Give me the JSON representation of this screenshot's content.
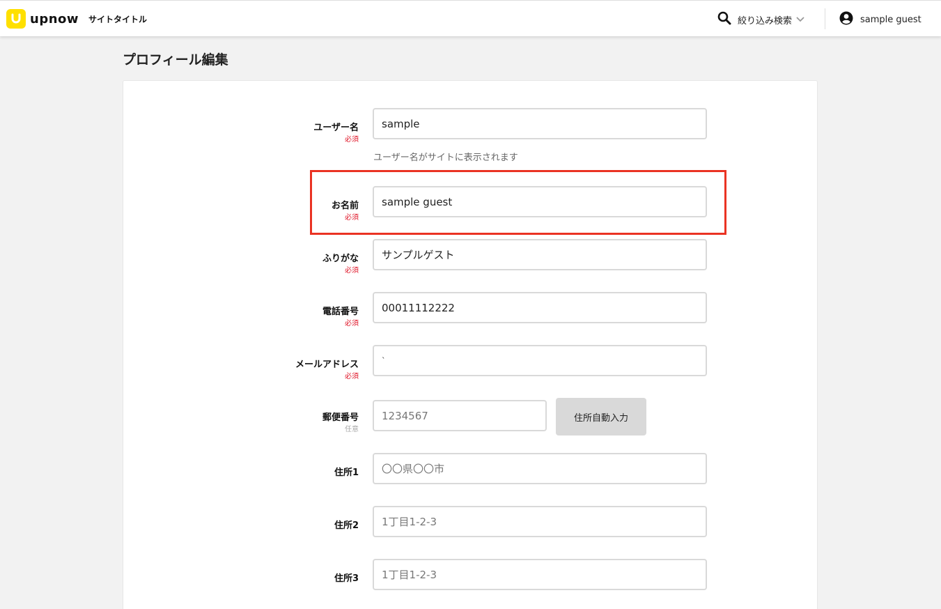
{
  "header": {
    "logo_text": "upnow",
    "site_title": "サイトタイトル",
    "search_label": "絞り込み検索",
    "user_name": "sample guest"
  },
  "page_title": "プロフィール編集",
  "form": {
    "username": {
      "label": "ユーザー名",
      "badge": "必須",
      "value": "sample",
      "helper": "ユーザー名がサイトに表示されます"
    },
    "name": {
      "label": "お名前",
      "badge": "必須",
      "value": "sample guest"
    },
    "furigana": {
      "label": "ふりがな",
      "badge": "必須",
      "value": "サンプルゲスト"
    },
    "phone": {
      "label": "電話番号",
      "badge": "必須",
      "value": "00011112222"
    },
    "email": {
      "label": "メールアドレス",
      "badge": "必須",
      "value": "`"
    },
    "postal": {
      "label": "郵便番号",
      "badge": "任意",
      "placeholder": "1234567",
      "button": "住所自動入力"
    },
    "address1": {
      "label": "住所1",
      "placeholder": "〇〇県〇〇市"
    },
    "address2": {
      "label": "住所2",
      "placeholder": "1丁目1-2-3"
    },
    "address3": {
      "label": "住所3",
      "placeholder": "1丁目1-2-3"
    }
  },
  "colors": {
    "brand_yellow": "#ffe000",
    "required_red": "#e0192b",
    "highlight_red": "#ea3323",
    "background": "#f2f2f2"
  }
}
